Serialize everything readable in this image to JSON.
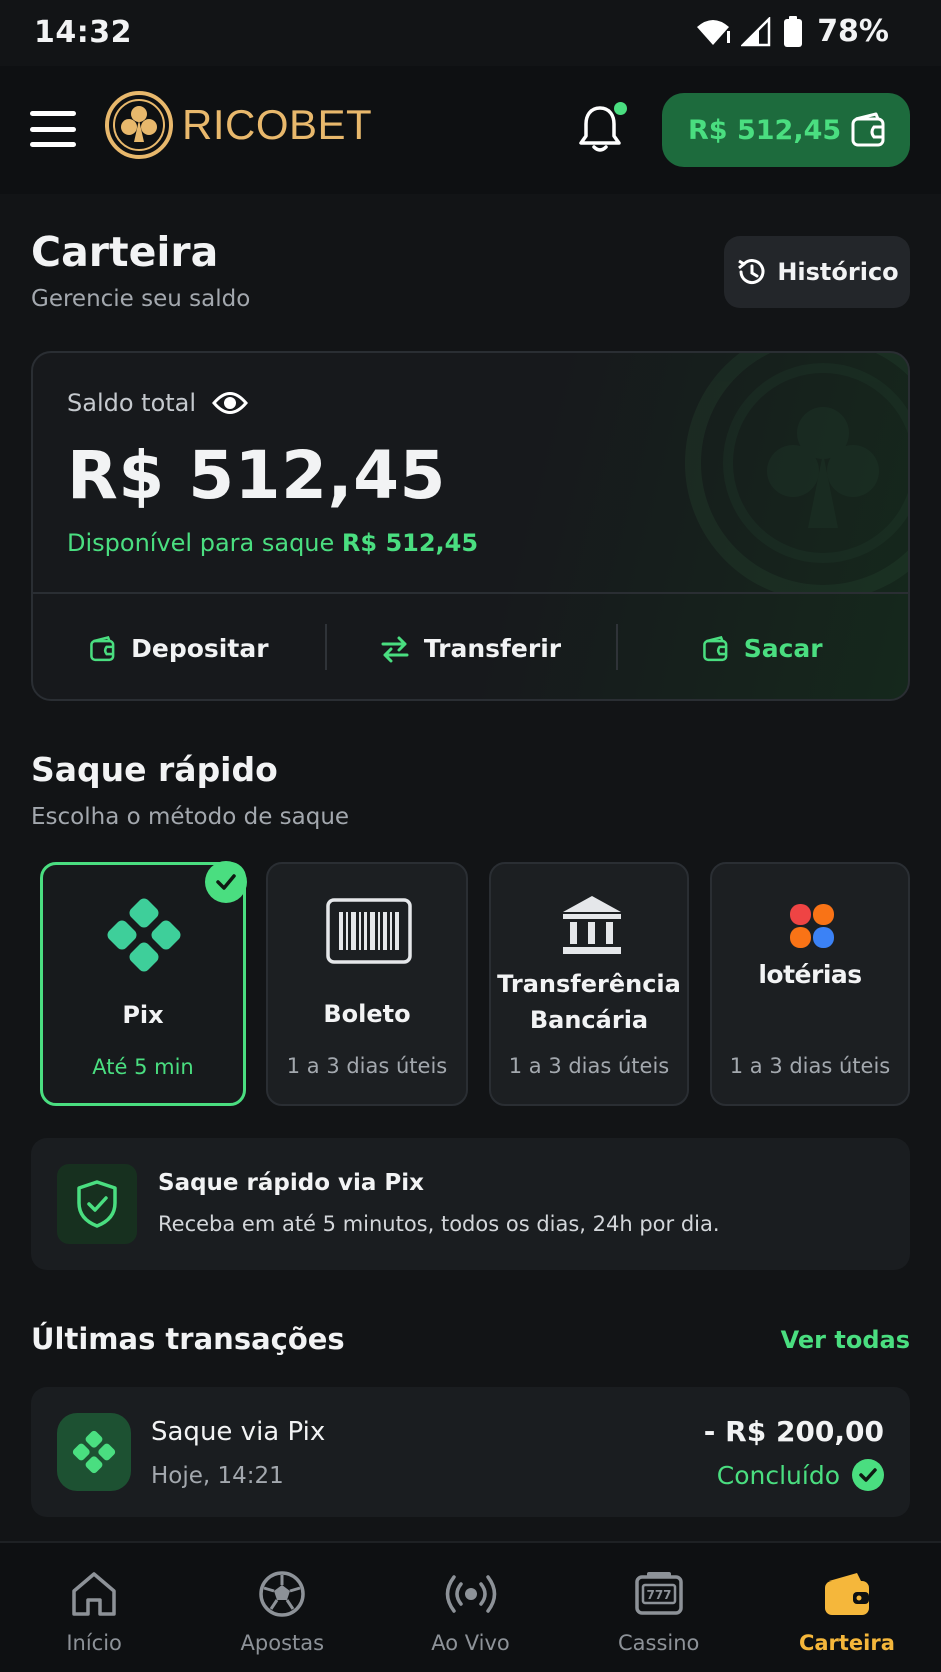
{
  "status_bar": {
    "time": "14:32",
    "battery": "78%"
  },
  "header": {
    "brand": "RICOBET",
    "balance": "R$ 512,45"
  },
  "page": {
    "title": "Carteira",
    "subtitle": "Gerencie seu saldo",
    "history_label": "Histórico"
  },
  "balance_card": {
    "label": "Saldo total",
    "amount": "R$ 512,45",
    "available_label": "Disponível para saque",
    "available_amount": "R$ 512,45",
    "actions": [
      {
        "label": "Depositar",
        "icon": "wallet-icon"
      },
      {
        "label": "Transferir",
        "icon": "transfer-icon"
      },
      {
        "label": "Sacar",
        "icon": "wallet-icon"
      }
    ]
  },
  "quick_withdraw": {
    "title": "Saque rápido",
    "subtitle": "Escolha o método de saque",
    "methods": [
      {
        "name": "Pix",
        "time": "Até 5 min",
        "icon": "pix-icon",
        "selected": true
      },
      {
        "name": "Boleto",
        "time": "1 a 3 dias úteis",
        "icon": "barcode-icon",
        "selected": false
      },
      {
        "name_line1": "Transferência",
        "name_line2": "Bancária",
        "time": "1 a 3 dias úteis",
        "icon": "bank-icon",
        "selected": false
      },
      {
        "logo_text": "lotérias",
        "time": "1 a 3 dias úteis",
        "icon": "loterias-logo",
        "selected": false
      }
    ]
  },
  "info": {
    "title": "Saque rápido via Pix",
    "text": "Receba em até 5 minutos, todos os dias, 24h por dia."
  },
  "transactions": {
    "title": "Últimas transações",
    "see_all": "Ver todas",
    "items": [
      {
        "title": "Saque via Pix",
        "date": "Hoje, 14:21",
        "amount": "- R$ 200,00",
        "status": "Concluído"
      }
    ]
  },
  "bottom_nav": [
    {
      "label": "Início",
      "icon": "home-icon",
      "active": false
    },
    {
      "label": "Apostas",
      "icon": "soccer-ball-icon",
      "active": false
    },
    {
      "label": "Ao Vivo",
      "icon": "live-broadcast-icon",
      "active": false
    },
    {
      "label": "Cassino",
      "icon": "slot-machine-icon",
      "active": false
    },
    {
      "label": "Carteira",
      "icon": "wallet-icon",
      "active": true
    }
  ],
  "colors": {
    "accent": "#4ade80",
    "brand_gold": "#e8b86c",
    "active_nav": "#f5b73b",
    "background": "#121416"
  }
}
